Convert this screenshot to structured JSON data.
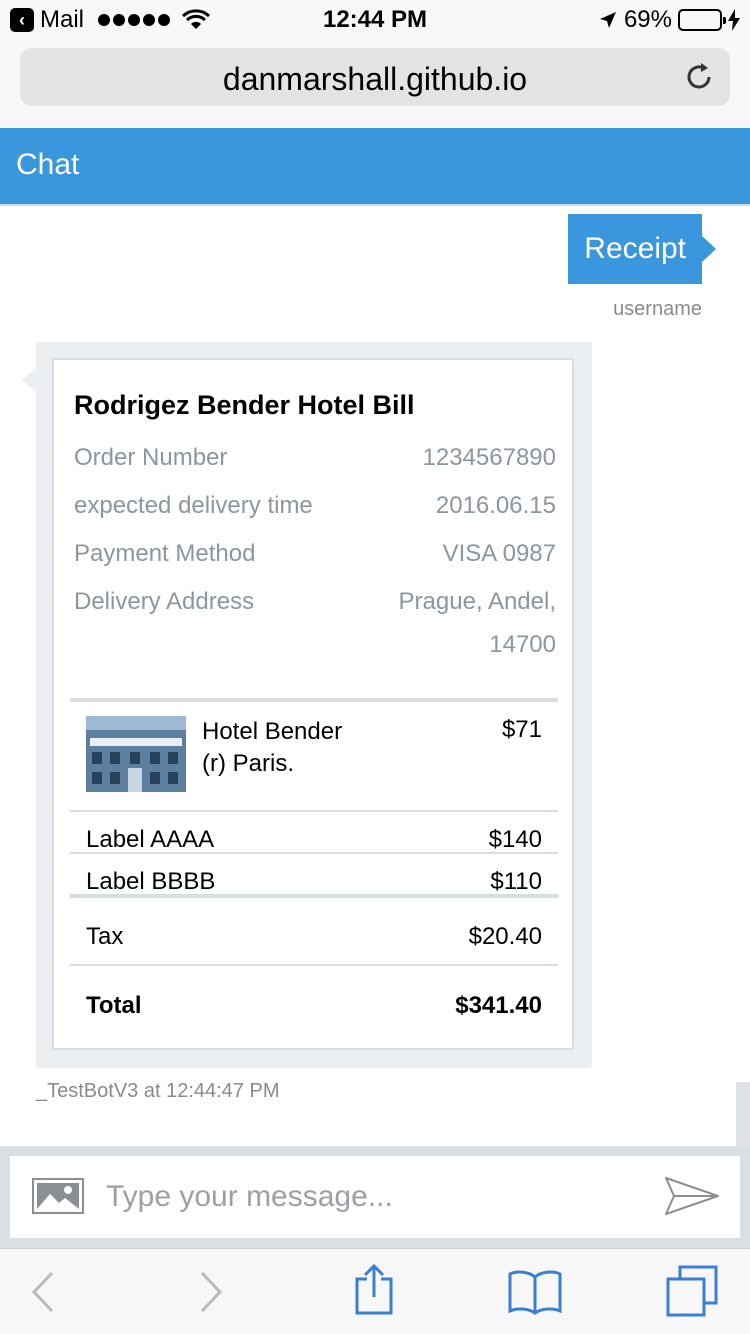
{
  "status_bar": {
    "carrier": "Mail",
    "time": "12:44 PM",
    "battery": "69%",
    "battery_level": 0.69
  },
  "browser": {
    "url": "danmarshall.github.io"
  },
  "chat": {
    "title": "Chat",
    "user_message": "Receipt",
    "user_name": "username",
    "bot_footer": "_TestBotV3 at 12:44:47 PM"
  },
  "receipt": {
    "title": "Rodrigez Bender Hotel Bill",
    "facts": [
      {
        "key": "Order Number",
        "value": "1234567890"
      },
      {
        "key": "expected delivery time",
        "value": "2016.06.15"
      },
      {
        "key": "Payment Method",
        "value": "VISA 0987"
      },
      {
        "key": "Delivery Address",
        "value": "Prague, Andel,",
        "value2": "14700"
      }
    ],
    "item": {
      "title": "Hotel Bender (r) Paris.",
      "price": "$71"
    },
    "lines": [
      {
        "label": "Label AAAA",
        "price": "$140"
      },
      {
        "label": "Label BBBB",
        "price": "$110"
      }
    ],
    "tax": {
      "label": "Tax",
      "value": "$20.40"
    },
    "total": {
      "label": "Total",
      "value": "$341.40"
    }
  },
  "composer": {
    "placeholder": "Type your message..."
  },
  "colors": {
    "accent": "#3a96dd",
    "battery": "#ffcc00"
  }
}
